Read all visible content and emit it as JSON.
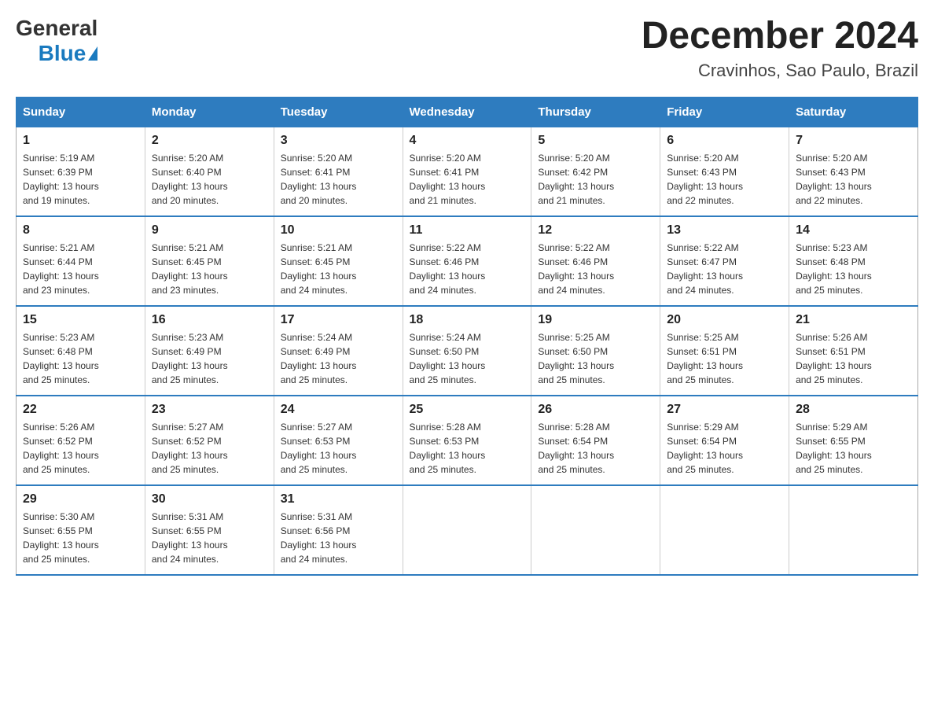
{
  "header": {
    "logo": {
      "general": "General",
      "blue": "Blue"
    },
    "title": "December 2024",
    "location": "Cravinhos, Sao Paulo, Brazil"
  },
  "days_of_week": [
    "Sunday",
    "Monday",
    "Tuesday",
    "Wednesday",
    "Thursday",
    "Friday",
    "Saturday"
  ],
  "weeks": [
    [
      {
        "day": "1",
        "sunrise": "5:19 AM",
        "sunset": "6:39 PM",
        "daylight": "13 hours and 19 minutes."
      },
      {
        "day": "2",
        "sunrise": "5:20 AM",
        "sunset": "6:40 PM",
        "daylight": "13 hours and 20 minutes."
      },
      {
        "day": "3",
        "sunrise": "5:20 AM",
        "sunset": "6:41 PM",
        "daylight": "13 hours and 20 minutes."
      },
      {
        "day": "4",
        "sunrise": "5:20 AM",
        "sunset": "6:41 PM",
        "daylight": "13 hours and 21 minutes."
      },
      {
        "day": "5",
        "sunrise": "5:20 AM",
        "sunset": "6:42 PM",
        "daylight": "13 hours and 21 minutes."
      },
      {
        "day": "6",
        "sunrise": "5:20 AM",
        "sunset": "6:43 PM",
        "daylight": "13 hours and 22 minutes."
      },
      {
        "day": "7",
        "sunrise": "5:20 AM",
        "sunset": "6:43 PM",
        "daylight": "13 hours and 22 minutes."
      }
    ],
    [
      {
        "day": "8",
        "sunrise": "5:21 AM",
        "sunset": "6:44 PM",
        "daylight": "13 hours and 23 minutes."
      },
      {
        "day": "9",
        "sunrise": "5:21 AM",
        "sunset": "6:45 PM",
        "daylight": "13 hours and 23 minutes."
      },
      {
        "day": "10",
        "sunrise": "5:21 AM",
        "sunset": "6:45 PM",
        "daylight": "13 hours and 24 minutes."
      },
      {
        "day": "11",
        "sunrise": "5:22 AM",
        "sunset": "6:46 PM",
        "daylight": "13 hours and 24 minutes."
      },
      {
        "day": "12",
        "sunrise": "5:22 AM",
        "sunset": "6:46 PM",
        "daylight": "13 hours and 24 minutes."
      },
      {
        "day": "13",
        "sunrise": "5:22 AM",
        "sunset": "6:47 PM",
        "daylight": "13 hours and 24 minutes."
      },
      {
        "day": "14",
        "sunrise": "5:23 AM",
        "sunset": "6:48 PM",
        "daylight": "13 hours and 25 minutes."
      }
    ],
    [
      {
        "day": "15",
        "sunrise": "5:23 AM",
        "sunset": "6:48 PM",
        "daylight": "13 hours and 25 minutes."
      },
      {
        "day": "16",
        "sunrise": "5:23 AM",
        "sunset": "6:49 PM",
        "daylight": "13 hours and 25 minutes."
      },
      {
        "day": "17",
        "sunrise": "5:24 AM",
        "sunset": "6:49 PM",
        "daylight": "13 hours and 25 minutes."
      },
      {
        "day": "18",
        "sunrise": "5:24 AM",
        "sunset": "6:50 PM",
        "daylight": "13 hours and 25 minutes."
      },
      {
        "day": "19",
        "sunrise": "5:25 AM",
        "sunset": "6:50 PM",
        "daylight": "13 hours and 25 minutes."
      },
      {
        "day": "20",
        "sunrise": "5:25 AM",
        "sunset": "6:51 PM",
        "daylight": "13 hours and 25 minutes."
      },
      {
        "day": "21",
        "sunrise": "5:26 AM",
        "sunset": "6:51 PM",
        "daylight": "13 hours and 25 minutes."
      }
    ],
    [
      {
        "day": "22",
        "sunrise": "5:26 AM",
        "sunset": "6:52 PM",
        "daylight": "13 hours and 25 minutes."
      },
      {
        "day": "23",
        "sunrise": "5:27 AM",
        "sunset": "6:52 PM",
        "daylight": "13 hours and 25 minutes."
      },
      {
        "day": "24",
        "sunrise": "5:27 AM",
        "sunset": "6:53 PM",
        "daylight": "13 hours and 25 minutes."
      },
      {
        "day": "25",
        "sunrise": "5:28 AM",
        "sunset": "6:53 PM",
        "daylight": "13 hours and 25 minutes."
      },
      {
        "day": "26",
        "sunrise": "5:28 AM",
        "sunset": "6:54 PM",
        "daylight": "13 hours and 25 minutes."
      },
      {
        "day": "27",
        "sunrise": "5:29 AM",
        "sunset": "6:54 PM",
        "daylight": "13 hours and 25 minutes."
      },
      {
        "day": "28",
        "sunrise": "5:29 AM",
        "sunset": "6:55 PM",
        "daylight": "13 hours and 25 minutes."
      }
    ],
    [
      {
        "day": "29",
        "sunrise": "5:30 AM",
        "sunset": "6:55 PM",
        "daylight": "13 hours and 25 minutes."
      },
      {
        "day": "30",
        "sunrise": "5:31 AM",
        "sunset": "6:55 PM",
        "daylight": "13 hours and 24 minutes."
      },
      {
        "day": "31",
        "sunrise": "5:31 AM",
        "sunset": "6:56 PM",
        "daylight": "13 hours and 24 minutes."
      },
      null,
      null,
      null,
      null
    ]
  ],
  "labels": {
    "sunrise": "Sunrise:",
    "sunset": "Sunset:",
    "daylight": "Daylight:"
  }
}
